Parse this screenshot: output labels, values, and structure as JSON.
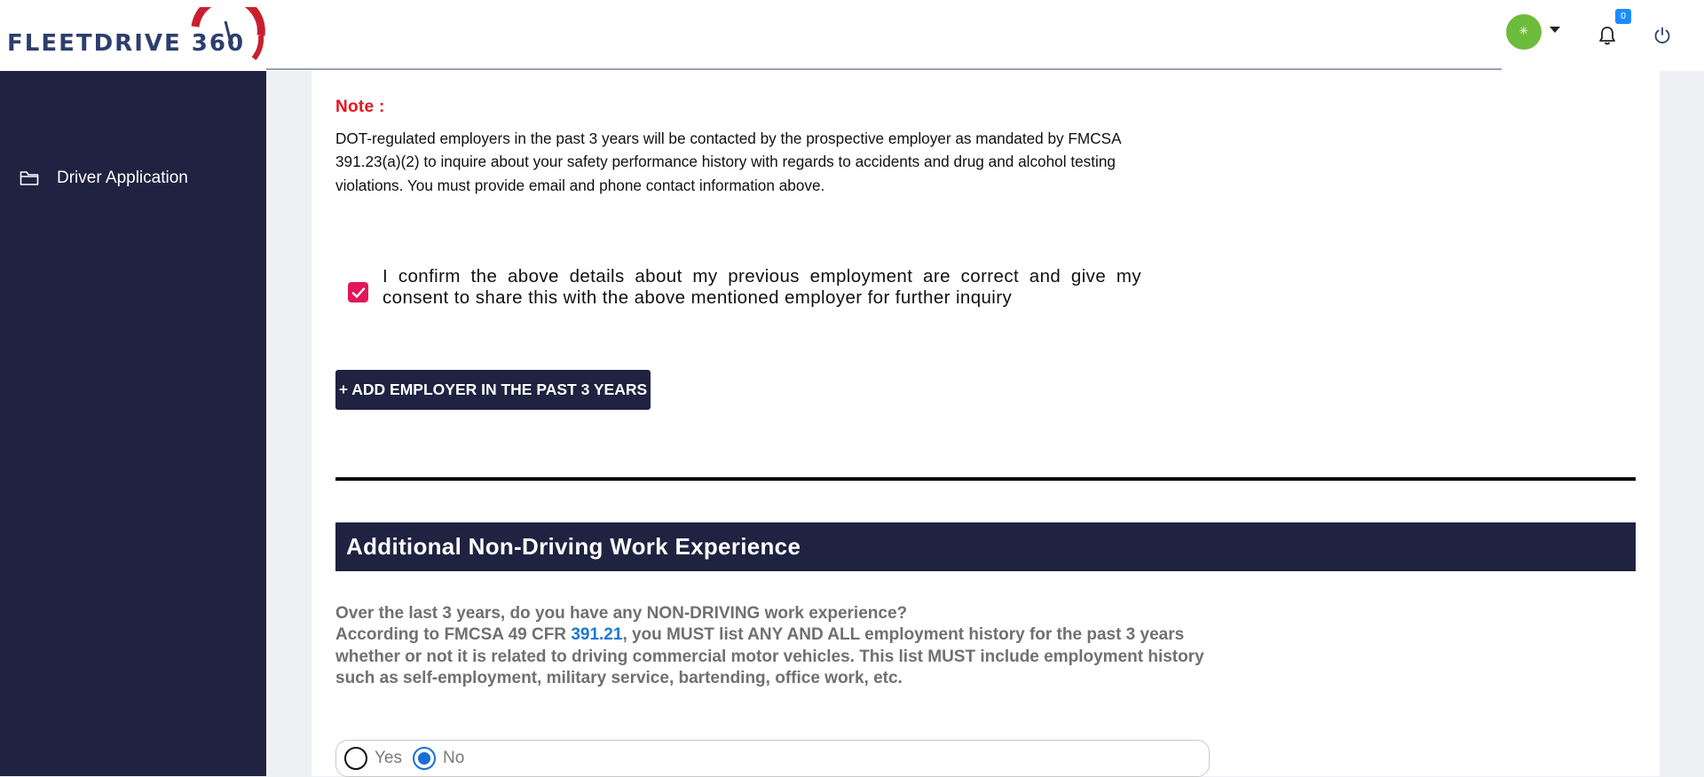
{
  "header": {
    "logo_text": "FLEETDRIVE 360",
    "avatar_glyph": "✳",
    "notification_count": "0"
  },
  "sidebar": {
    "items": [
      {
        "label": "Driver Application",
        "icon": "folder-icon"
      }
    ]
  },
  "note": {
    "title": "Note :",
    "body": "DOT-regulated employers in the past 3 years will be contacted by the prospective employer as mandated by FMCSA 391.23(a)(2) to inquire about your safety performance history with regards to accidents and drug and alcohol testing violations. You must provide email and phone contact information above."
  },
  "consent": {
    "checked": true,
    "text": "I confirm the above details about my previous employment are correct and give my consent to share this with the above mentioned employer for further inquiry"
  },
  "add_employer_button": "+ ADD EMPLOYER IN THE PAST 3 YEARS",
  "section": {
    "title": "Additional Non-Driving Work Experience",
    "question_line1": "Over the last 3 years, do you have any NON-DRIVING work experience?",
    "question_prefix": "According to FMCSA 49 CFR ",
    "question_ref": "391.21",
    "question_suffix": ", you MUST list ANY AND ALL employment history for the past 3 years whether or not it is related to driving commercial motor vehicles. This list MUST include employment history such as self-employment, military service, bartending, office work, etc.",
    "options": [
      {
        "label": "Yes",
        "selected": false
      },
      {
        "label": "No",
        "selected": true
      }
    ]
  },
  "colors": {
    "navy": "#1f2240",
    "accent_red": "#e8141c",
    "checkbox_pink": "#e0175a",
    "link_blue": "#1b78d8",
    "avatar_green": "#6dbb3a",
    "badge_blue": "#1a8cff"
  }
}
